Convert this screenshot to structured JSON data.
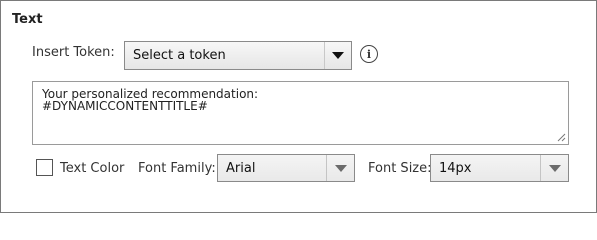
{
  "section": {
    "title": "Text"
  },
  "insert_token": {
    "label": "Insert Token:",
    "selected": "Select a token",
    "info_icon": "info-icon"
  },
  "editor": {
    "lines": [
      "Your personalized recommendation:",
      " #DYNAMICCONTENTTITLE#"
    ]
  },
  "text_color": {
    "label": "Text Color",
    "checked": false
  },
  "font_family": {
    "label": "Font Family:",
    "selected": "Arial"
  },
  "font_size": {
    "label": "Font Size:",
    "selected": "14px"
  },
  "icons": {
    "dropdown": "chevron-down-icon",
    "resize": "resize-grip-icon"
  }
}
